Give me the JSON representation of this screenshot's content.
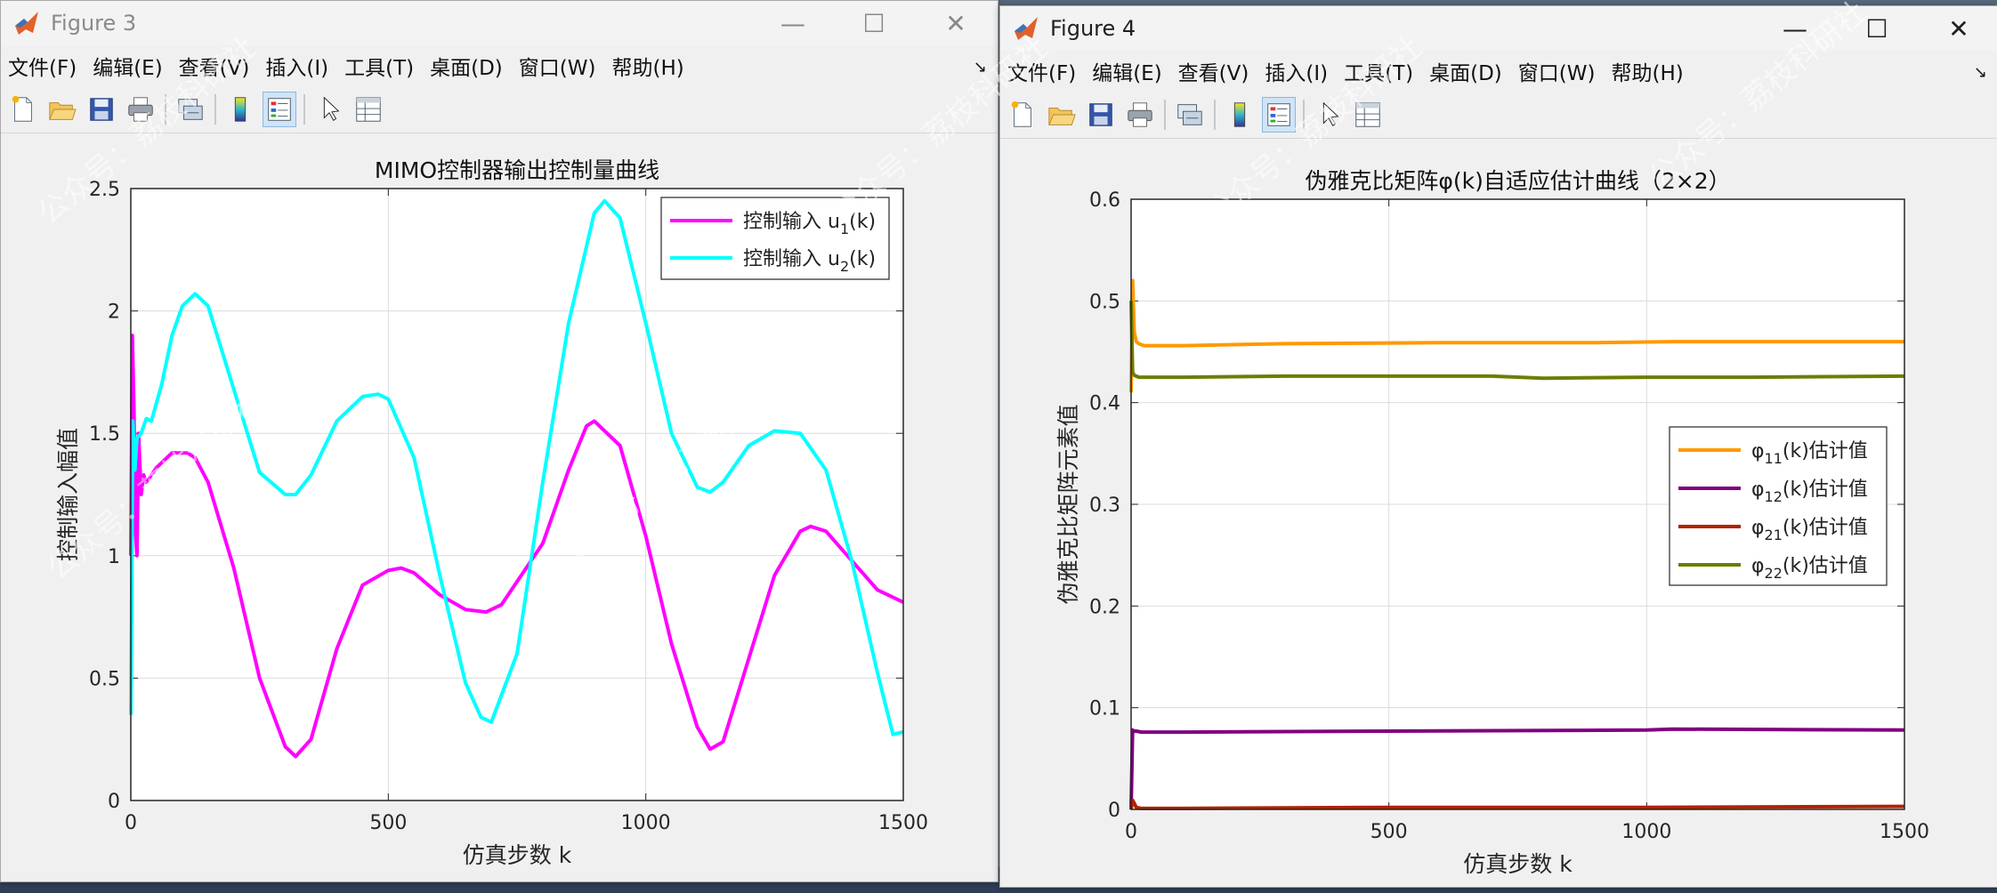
{
  "fig3": {
    "title": "Figure 3",
    "menu": [
      "文件(F)",
      "编辑(E)",
      "查看(V)",
      "插入(I)",
      "工具(T)",
      "桌面(D)",
      "窗口(W)",
      "帮助(H)"
    ],
    "dock_glyph": "↘"
  },
  "fig4": {
    "title": "Figure 4",
    "menu": [
      "文件(F)",
      "编辑(E)",
      "查看(V)",
      "插入(I)",
      "工具(T)",
      "桌面(D)",
      "窗口(W)",
      "帮助(H)"
    ],
    "dock_glyph": "↘"
  },
  "window_controls": {
    "minimize": "—",
    "maximize": "☐",
    "close": "✕"
  },
  "icons": [
    "new-file-icon",
    "open-folder-icon",
    "save-icon",
    "print-icon",
    "link-icon",
    "colorbar-icon",
    "legend-icon",
    "pointer-icon",
    "property-editor-icon"
  ],
  "watermark": "公众号：荔枝科研社",
  "chart_data": [
    {
      "type": "line",
      "title": "MIMO控制器输出控制量曲线",
      "xlabel": "仿真步数 k",
      "ylabel": "控制输入幅值",
      "xlim": [
        0,
        1500
      ],
      "ylim": [
        0,
        2.5
      ],
      "xticks": [
        "0",
        "500",
        "1000",
        "1500"
      ],
      "yticks": [
        "0",
        "0.5",
        "1",
        "1.5",
        "2",
        "2.5"
      ],
      "grid": true,
      "legend_position": "top-right",
      "series": [
        {
          "name": "控制输入 u",
          "name_sub": "1",
          "name_suffix": "(k)",
          "color": "#ff00ff",
          "x": [
            0,
            3,
            6,
            9,
            12,
            15,
            20,
            25,
            30,
            40,
            50,
            80,
            110,
            125,
            150,
            200,
            250,
            300,
            320,
            350,
            400,
            450,
            500,
            525,
            550,
            600,
            650,
            690,
            720,
            800,
            850,
            885,
            900,
            950,
            1000,
            1050,
            1100,
            1125,
            1150,
            1200,
            1250,
            1300,
            1320,
            1350,
            1400,
            1450,
            1500
          ],
          "y": [
            1.0,
            1.9,
            1.6,
            1.1,
            1.0,
            1.5,
            1.25,
            1.33,
            1.3,
            1.33,
            1.36,
            1.42,
            1.42,
            1.4,
            1.3,
            0.95,
            0.5,
            0.22,
            0.18,
            0.25,
            0.62,
            0.88,
            0.94,
            0.95,
            0.93,
            0.84,
            0.78,
            0.77,
            0.8,
            1.05,
            1.35,
            1.53,
            1.55,
            1.45,
            1.08,
            0.64,
            0.3,
            0.21,
            0.24,
            0.58,
            0.92,
            1.1,
            1.12,
            1.1,
            0.98,
            0.86,
            0.81
          ]
        },
        {
          "name": "控制输入 u",
          "name_sub": "2",
          "name_suffix": "(k)",
          "color": "#00ffff",
          "x": [
            0,
            4,
            8,
            12,
            20,
            30,
            40,
            60,
            80,
            100,
            125,
            150,
            200,
            250,
            300,
            320,
            350,
            400,
            450,
            480,
            500,
            550,
            600,
            650,
            680,
            700,
            750,
            800,
            850,
            900,
            920,
            950,
            1000,
            1050,
            1100,
            1125,
            1150,
            1200,
            1250,
            1300,
            1350,
            1400,
            1450,
            1480,
            1500
          ],
          "y": [
            0.35,
            1.55,
            1.35,
            1.48,
            1.5,
            1.56,
            1.55,
            1.7,
            1.9,
            2.02,
            2.07,
            2.02,
            1.68,
            1.34,
            1.25,
            1.25,
            1.33,
            1.55,
            1.65,
            1.66,
            1.64,
            1.4,
            0.92,
            0.48,
            0.34,
            0.32,
            0.6,
            1.3,
            1.95,
            2.4,
            2.45,
            2.38,
            1.95,
            1.5,
            1.28,
            1.26,
            1.3,
            1.45,
            1.51,
            1.5,
            1.35,
            0.98,
            0.52,
            0.27,
            0.28
          ]
        }
      ]
    },
    {
      "type": "line",
      "title": "伪雅克比矩阵φ(k)自适应估计曲线（2×2）",
      "xlabel": "仿真步数 k",
      "ylabel": "伪雅克比矩阵元素值",
      "xlim": [
        0,
        1500
      ],
      "ylim": [
        0,
        0.6
      ],
      "xticks": [
        "0",
        "500",
        "1000",
        "1500"
      ],
      "yticks": [
        "0",
        "0.1",
        "0.2",
        "0.3",
        "0.4",
        "0.5",
        "0.6"
      ],
      "grid": true,
      "legend_position": "middle-right",
      "series": [
        {
          "name": "φ",
          "name_sub": "11",
          "name_suffix": "(k)估计值",
          "color": "#ff9900",
          "x": [
            0,
            3,
            6,
            10,
            15,
            25,
            40,
            100,
            300,
            600,
            900,
            1050,
            1200,
            1500
          ],
          "y": [
            0.41,
            0.52,
            0.47,
            0.46,
            0.458,
            0.456,
            0.456,
            0.456,
            0.458,
            0.459,
            0.459,
            0.46,
            0.46,
            0.46
          ]
        },
        {
          "name": "φ",
          "name_sub": "12",
          "name_suffix": "(k)估计值",
          "color": "#800080",
          "x": [
            0,
            3,
            6,
            10,
            20,
            40,
            100,
            500,
            1000,
            1050,
            1500
          ],
          "y": [
            0.0,
            0.078,
            0.077,
            0.077,
            0.076,
            0.076,
            0.076,
            0.077,
            0.078,
            0.079,
            0.078
          ]
        },
        {
          "name": "φ",
          "name_sub": "21",
          "name_suffix": "(k)估计值",
          "color": "#b22200",
          "x": [
            0,
            3,
            6,
            10,
            20,
            100,
            500,
            1000,
            1500
          ],
          "y": [
            0.0,
            0.009,
            0.006,
            0.002,
            0.001,
            0.001,
            0.002,
            0.002,
            0.003
          ]
        },
        {
          "name": "φ",
          "name_sub": "22",
          "name_suffix": "(k)估计值",
          "color": "#6e7d00",
          "x": [
            0,
            3,
            6,
            10,
            15,
            25,
            100,
            300,
            500,
            700,
            800,
            1000,
            1200,
            1500
          ],
          "y": [
            0.5,
            0.43,
            0.427,
            0.426,
            0.425,
            0.425,
            0.425,
            0.426,
            0.426,
            0.426,
            0.424,
            0.425,
            0.425,
            0.426
          ]
        }
      ]
    }
  ]
}
